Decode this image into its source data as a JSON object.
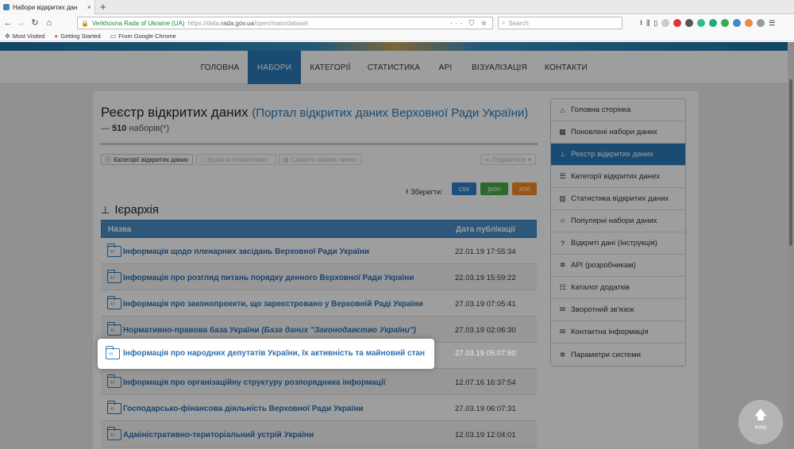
{
  "browser": {
    "tab_title": "Набори відкритих дан",
    "tab_close": "×",
    "new_tab": "+",
    "site_identity": "Verkhovna Rada of Ukraine (UA)",
    "url_host_prefix": "https://data.",
    "url_host": "rada.gov.ua",
    "url_path": "/open/main/dataset",
    "url_icons": "··· ⛉ ☆",
    "search_placeholder": "Search",
    "bookmarks": [
      {
        "icon": "gear-icon",
        "label": "Most Visited"
      },
      {
        "icon": "firefox-icon",
        "label": "Getting Started"
      },
      {
        "icon": "folder-icon",
        "label": "From Google Chrome"
      }
    ]
  },
  "nav": {
    "items": [
      "ГОЛОВНА",
      "НАБОРИ",
      "КАТЕГОРІЇ",
      "СТАТИСТИКА",
      "API",
      "ВІЗУАЛІЗАЦІЯ",
      "КОНТАКТИ"
    ],
    "active": "НАБОРИ"
  },
  "page": {
    "title": "Реєстр відкритих даних",
    "subtitle": "(Портал відкритих даних Верховної Ради України)",
    "count_prefix": "— ",
    "count": "510",
    "count_suffix": " наборів(*)",
    "buttons": {
      "categories": "Категорії відкритих даних",
      "home": "Зробити початковою",
      "hide_menu": "Сховати панель меню",
      "share": "Поділитися"
    },
    "save_label": "Зберегти:",
    "formats": [
      "csv",
      "json",
      "xml"
    ],
    "hierarchy_title": "Ієрархія"
  },
  "table": {
    "headers": [
      "Назва",
      "Дата публікації"
    ],
    "rows": [
      {
        "name": "Інформація щодо пленарних засідань Верховної Ради України",
        "italic": "",
        "date": "22.01.19 17:55:34"
      },
      {
        "name": "Інформація про розгляд питань порядку денного Верховної Ради України",
        "italic": "",
        "date": "22.03.19 15:59:22"
      },
      {
        "name": "Інформація про законопроекти, що зареєстровано у Верховній Раді України",
        "italic": "",
        "date": "27.03.19 07:05:41"
      },
      {
        "name": "Нормативно-правова база України ",
        "italic": "(База даних \"Законодавство України\")",
        "date": "27.03.19 02:06:30"
      },
      {
        "name": "Інформація про народних депутатів України, їх активність та майновий стан",
        "italic": "",
        "date": "27.03.19 05:07:50"
      },
      {
        "name": "Інформація про організаційну структуру розпорядника інформації",
        "italic": "",
        "date": "12.07.16 16:37:54"
      },
      {
        "name": "Господарсько-фінансова діяльність Верховної Ради України",
        "italic": "",
        "date": "27.03.19 06:07:31"
      },
      {
        "name": "Адміністративно-територіальний устрій України",
        "italic": "",
        "date": "12.03.19 12:04:01"
      }
    ]
  },
  "sidebar": {
    "items": [
      {
        "icon": "home-icon",
        "glyph": "⌂",
        "label": "Головна сторінка"
      },
      {
        "icon": "calendar-icon",
        "glyph": "▦",
        "label": "Поновлені набори даних"
      },
      {
        "icon": "sitemap-icon",
        "glyph": "⊥",
        "label": "Реєстр відкритих даних",
        "active": true
      },
      {
        "icon": "list-icon",
        "glyph": "☰",
        "label": "Категорії відкритих даних"
      },
      {
        "icon": "bar-chart-icon",
        "glyph": "▥",
        "label": "Статистика відкритих даних"
      },
      {
        "icon": "star-icon",
        "glyph": "☆",
        "label": "Популярні набори даних"
      },
      {
        "icon": "question-icon",
        "glyph": "?",
        "label": "Відкриті дані (Інструкція)"
      },
      {
        "icon": "gear-icon",
        "glyph": "✲",
        "label": "API (розробникам)"
      },
      {
        "icon": "list-alt-icon",
        "glyph": "☷",
        "label": "Каталог додатків"
      },
      {
        "icon": "comment-icon",
        "glyph": "✉",
        "label": "Зворотний зв'язок"
      },
      {
        "icon": "envelope-icon",
        "glyph": "✉",
        "label": "Контактна інформація"
      },
      {
        "icon": "cog-icon",
        "glyph": "✲",
        "label": "Параметри системи"
      }
    ]
  },
  "uptop": {
    "arrow": "🡅",
    "label": "вгору"
  },
  "colors": {
    "accent": "#2a7ab8",
    "csv": "#2f80c8",
    "json": "#4aa84a",
    "xml": "#f08a24"
  }
}
